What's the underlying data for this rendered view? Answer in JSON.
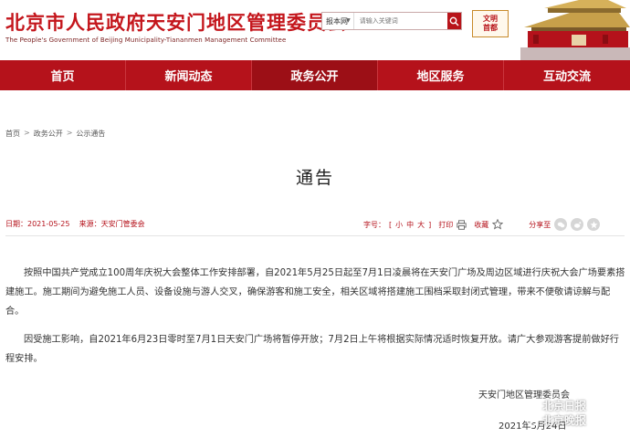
{
  "header": {
    "title": "北京市人民政府天安门地区管理委员会",
    "subtitle": "The People's Government of Beijing Municipality-Tiananmen Management Committee",
    "search": {
      "scope": "报本网",
      "placeholder": "请输入关键词"
    },
    "badge_line1": "文明",
    "badge_line2": "首都"
  },
  "nav": {
    "items": [
      {
        "label": "首页"
      },
      {
        "label": "新闻动态"
      },
      {
        "label": "政务公开"
      },
      {
        "label": "地区服务"
      },
      {
        "label": "互动交流"
      }
    ],
    "active_index": 2
  },
  "breadcrumb": [
    "首页",
    "政务公开",
    "公示通告"
  ],
  "article": {
    "title": "通告",
    "date_label": "日期：2021-05-25",
    "source_label": "来源：天安门管委会",
    "font_label": "字号：",
    "font_sizes": [
      "[",
      "小",
      "中",
      "大",
      "]"
    ],
    "print_label": "打印",
    "favorite_label": "收藏",
    "share_label": "分享至",
    "paragraphs": [
      "按照中国共产党成立100周年庆祝大会整体工作安排部署，自2021年5月25日起至7月1日凌晨将在天安门广场及周边区域进行庆祝大会广场要素搭建施工。施工期间为避免施工人员、设备设施与游人交叉，确保游客和施工安全，相关区域将搭建施工围档采取封闭式管理，带来不便敬请谅解与配合。",
      "因受施工影响，自2021年6月23日零时至7月1日天安门广场将暂停开放；7月2日上午将根据实际情况适时恢复开放。请广大参观游客提前做好行程安排。"
    ],
    "signature": "天安门地区管理委员会",
    "sign_date": "2021年5月24日"
  },
  "watermark": {
    "line1": "北京日报",
    "line2": "北京晚报"
  },
  "colors": {
    "brand_red": "#b5121b",
    "title_red": "#c4161c"
  }
}
